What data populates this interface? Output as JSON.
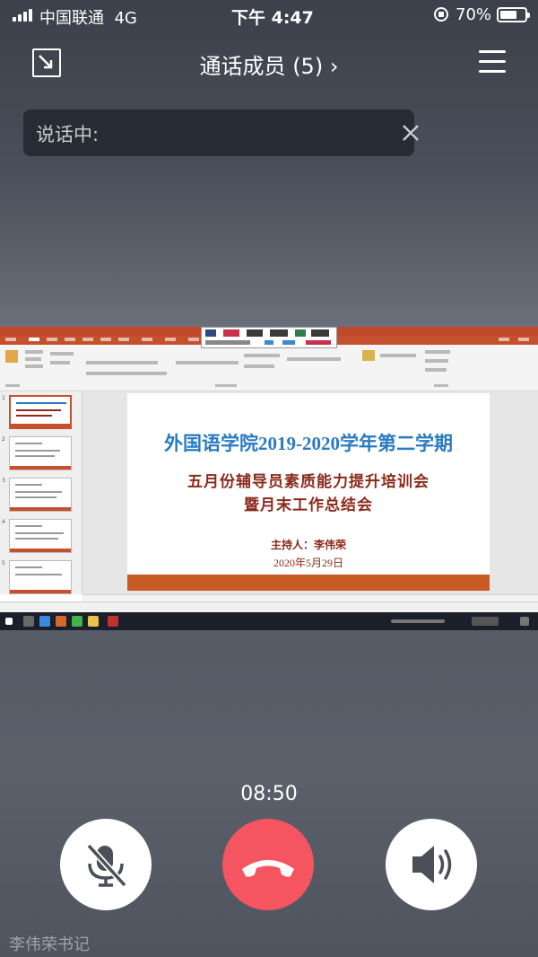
{
  "status_bar": {
    "carrier": "中国联通",
    "network": "4G",
    "time": "下午 4:47",
    "battery": "70%",
    "battery_level": 0.7
  },
  "call": {
    "members_title": "通话成员 (5) ›",
    "speaking_label": "说话中:",
    "duration": "08:50"
  },
  "shared_slide": {
    "title": "外国语学院2019-2020学年第二学期",
    "subtitle_1": "五月份辅导员素质能力提升培训会",
    "subtitle_2": "暨月末工作总结会",
    "host": "主持人：李伟荣",
    "date": "2020年5月29日"
  },
  "controls": {
    "mute": "mic-off-icon",
    "hangup": "phone-hangup-icon",
    "speaker": "speaker-icon"
  },
  "colors": {
    "hangup": "#f45560",
    "slide_title": "#2a7ac2",
    "slide_text": "#8b2a1b",
    "ppt_accent": "#c5502e"
  },
  "watermark": "李伟荣书记"
}
